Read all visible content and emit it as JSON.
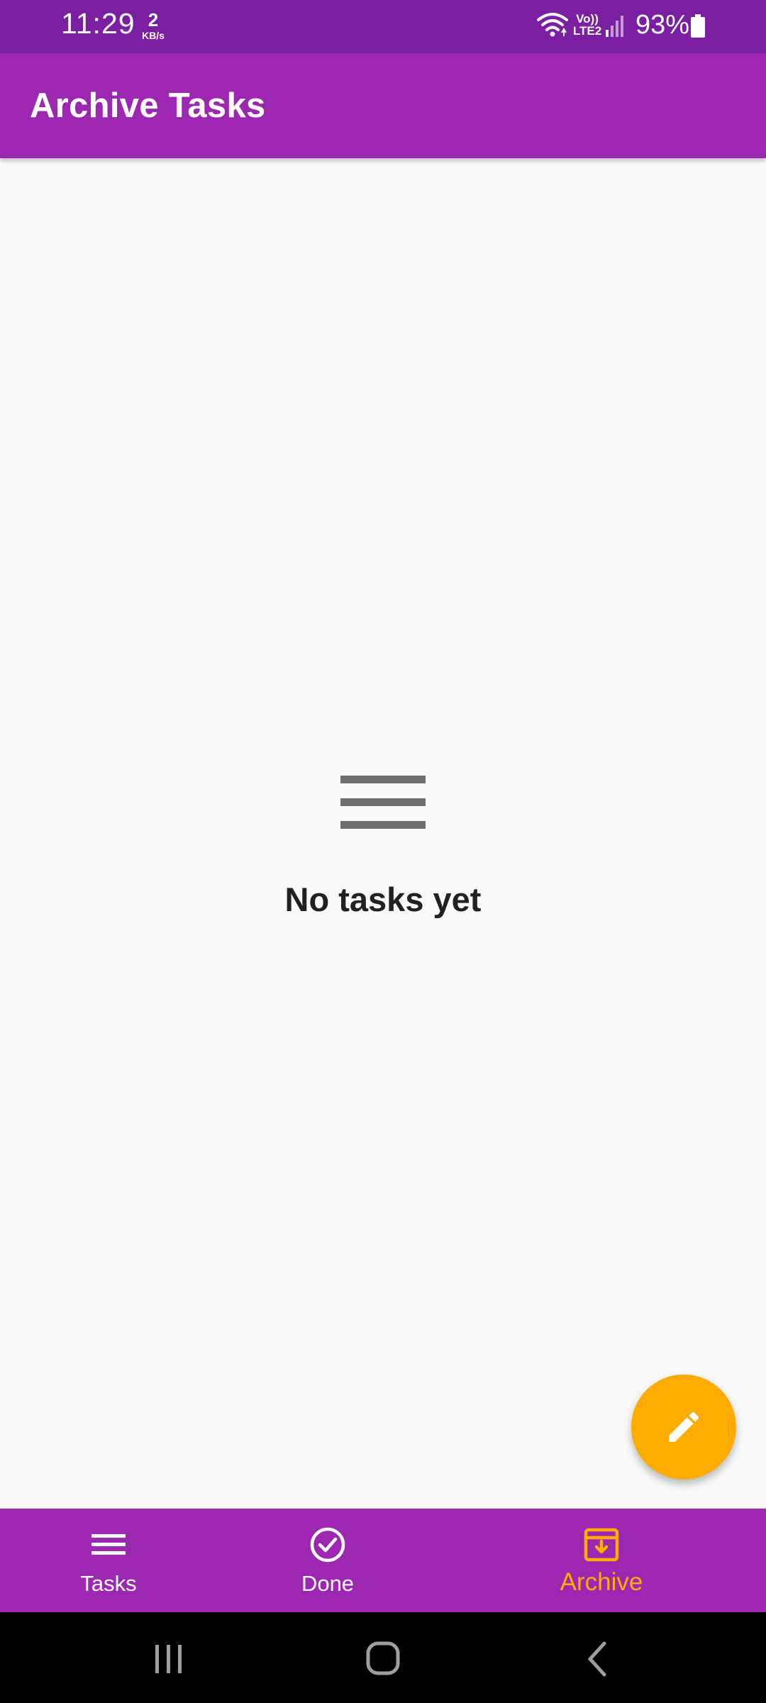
{
  "status_bar": {
    "time": "11:29",
    "net_speed_value": "2",
    "net_speed_unit": "KB/s",
    "volte_label": "Vo))",
    "lte_label": "LTE2",
    "battery_percent": "93%",
    "icons": [
      "wifi-icon",
      "signal-icon",
      "battery-icon"
    ]
  },
  "app_bar": {
    "title": "Archive Tasks"
  },
  "empty_state": {
    "icon": "menu-lines-icon",
    "message": "No tasks yet"
  },
  "fab": {
    "icon": "pencil-icon"
  },
  "bottom_nav": {
    "selected": "Archive",
    "items": [
      {
        "label": "Tasks",
        "icon": "menu-icon"
      },
      {
        "label": "Done",
        "icon": "check-circle-icon"
      },
      {
        "label": "Archive",
        "icon": "archive-icon"
      }
    ]
  },
  "system_nav": {
    "buttons": [
      "recents-icon",
      "home-icon",
      "back-icon"
    ]
  },
  "colors": {
    "status_bar": "#7b1fa2",
    "primary": "#9c27b0",
    "accent": "#ffab00",
    "background": "#fafafa",
    "empty_icon": "#6d6d6d",
    "text_dark": "#212121"
  }
}
